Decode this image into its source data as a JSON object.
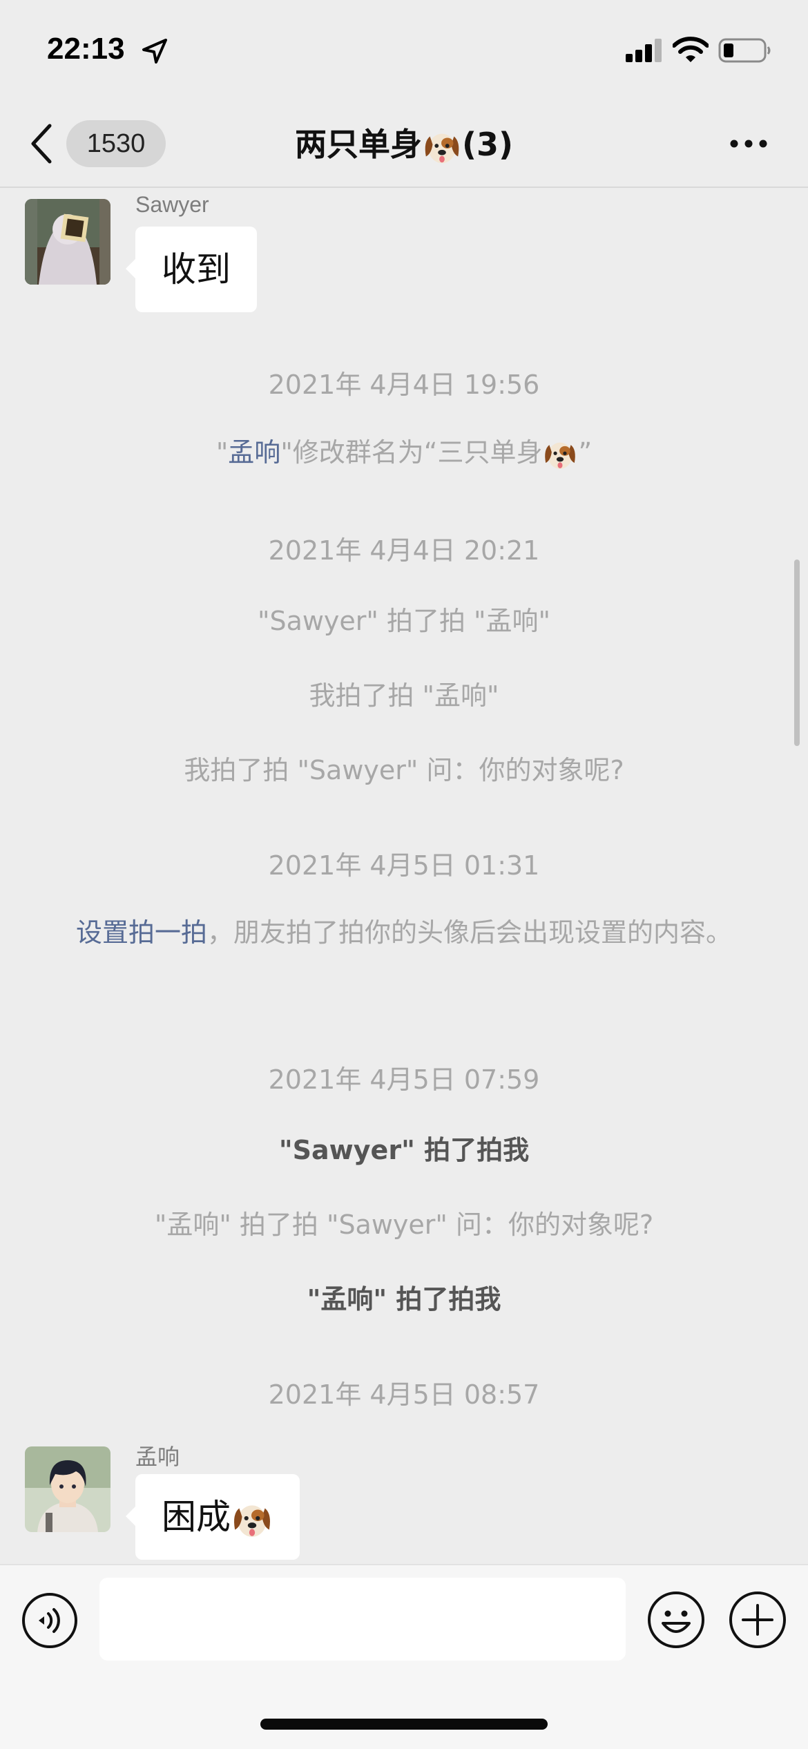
{
  "status_bar": {
    "time": "22:13"
  },
  "nav": {
    "unread_count": "1530",
    "title_prefix": "两只单身",
    "title_suffix": "(3)"
  },
  "messages": {
    "m1": {
      "sender": "Sawyer",
      "text": "收到"
    },
    "ts1": "2021年 4月4日 19:56",
    "rename": {
      "quote_open": "\"",
      "actor": "孟响",
      "action": "\"修改群名为“三只单身",
      "quote_close": "”"
    },
    "ts2": "2021年 4月4日 20:21",
    "pat1": "\"Sawyer\" 拍了拍 \"孟响\"",
    "pat2": "我拍了拍 \"孟响\"",
    "pat3": "我拍了拍 \"Sawyer\" 问：你的对象呢?",
    "ts3": "2021年 4月5日 01:31",
    "hint": {
      "link": "设置拍一拍",
      "text": "，朋友拍了拍你的头像后会出现设置的内容。"
    },
    "ts4": "2021年 4月5日 07:59",
    "pat4": "\"Sawyer\" 拍了拍我",
    "pat5": "\"孟响\" 拍了拍 \"Sawyer\" 问：你的对象呢?",
    "pat6": "\"孟响\" 拍了拍我",
    "ts5": "2021年 4月5日 08:57",
    "m2": {
      "sender": "孟响",
      "text": "困成"
    }
  },
  "colors": {
    "background": "#ededed",
    "link": "#576b95",
    "system_text": "#a7a7a7",
    "bubble": "#ffffff"
  },
  "icons": [
    "location-arrow-icon",
    "cellular-signal-icon",
    "wifi-icon",
    "battery-icon",
    "back-chevron-icon",
    "more-dots-icon",
    "dog-face-emoji",
    "voice-icon",
    "emoji-icon",
    "plus-icon"
  ]
}
